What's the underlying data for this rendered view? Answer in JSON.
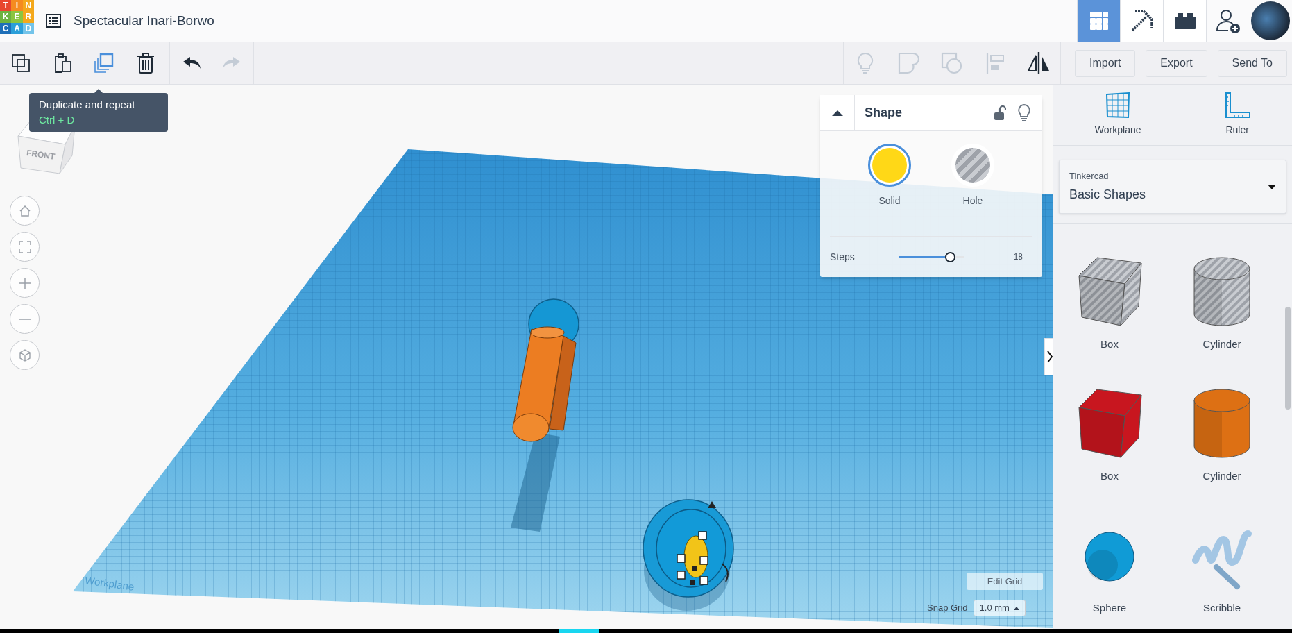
{
  "logo": {
    "letters": [
      {
        "text": "T",
        "color": "#e8472f"
      },
      {
        "text": "I",
        "color": "#f58b1f"
      },
      {
        "text": "N",
        "color": "#f4a81c"
      },
      {
        "text": "K",
        "color": "#6cb33f"
      },
      {
        "text": "E",
        "color": "#8cc540"
      },
      {
        "text": "R",
        "color": "#f4a81c"
      },
      {
        "text": "C",
        "color": "#1e6fb8"
      },
      {
        "text": "A",
        "color": "#2b9fd9"
      },
      {
        "text": "D",
        "color": "#74c4ea"
      }
    ]
  },
  "title": "Spectacular Inari-Borwo",
  "view_modes": [
    {
      "selected": true
    },
    {
      "selected": false
    },
    {
      "selected": false
    }
  ],
  "toolbar": {
    "edit_tools": [
      {
        "kind": "copy",
        "disabled": false,
        "highlighted": false
      },
      {
        "kind": "paste",
        "disabled": false,
        "highlighted": false
      },
      {
        "kind": "duplicate",
        "disabled": false,
        "highlighted": true
      },
      {
        "kind": "delete",
        "disabled": false,
        "highlighted": false
      }
    ],
    "history_tools": [
      {
        "kind": "undo",
        "disabled": false
      },
      {
        "kind": "redo",
        "disabled": true
      }
    ],
    "shape_tools": [
      {
        "kind": "bulb",
        "disabled": true
      },
      {
        "kind": "group",
        "disabled": true
      },
      {
        "kind": "ungroup",
        "disabled": true
      },
      {
        "kind": "align",
        "disabled": true
      },
      {
        "kind": "mirror",
        "disabled": false
      }
    ],
    "buttons": [
      "Import",
      "Export",
      "Send To"
    ]
  },
  "tooltip": {
    "title": "Duplicate and repeat",
    "shortcut": "Ctrl + D"
  },
  "view_cube": {
    "face": "FRONT"
  },
  "workplane_label": "Workplane",
  "shape_panel": {
    "title": "Shape",
    "expanded": true,
    "modes": [
      {
        "label": "Solid",
        "selected": true
      },
      {
        "label": "Hole",
        "selected": false
      }
    ],
    "steps": {
      "label": "Steps",
      "level": 0.78,
      "reading": "18"
    }
  },
  "grid_controls": {
    "edit_button": "Edit Grid",
    "snap_label": "Snap Grid",
    "snap_value": "1.0 mm"
  },
  "sidebar": {
    "tools": [
      "Workplane",
      "Ruler"
    ],
    "library": {
      "provider": "Tinkercad",
      "name": "Basic Shapes"
    },
    "shapes": [
      {
        "label": "Box",
        "kind": "box",
        "hole": true
      },
      {
        "label": "Cylinder",
        "kind": "cylinder",
        "hole": true
      },
      {
        "label": "Box",
        "kind": "box",
        "hole": false,
        "color": "#c8161f"
      },
      {
        "label": "Cylinder",
        "kind": "cylinder",
        "hole": false,
        "color": "#dd7014"
      },
      {
        "label": "Sphere",
        "kind": "sphere",
        "hole": false,
        "color": "#109bd6"
      },
      {
        "label": "Scribble",
        "kind": "scribble",
        "hole": false,
        "color": "#a3c6e4"
      }
    ]
  }
}
